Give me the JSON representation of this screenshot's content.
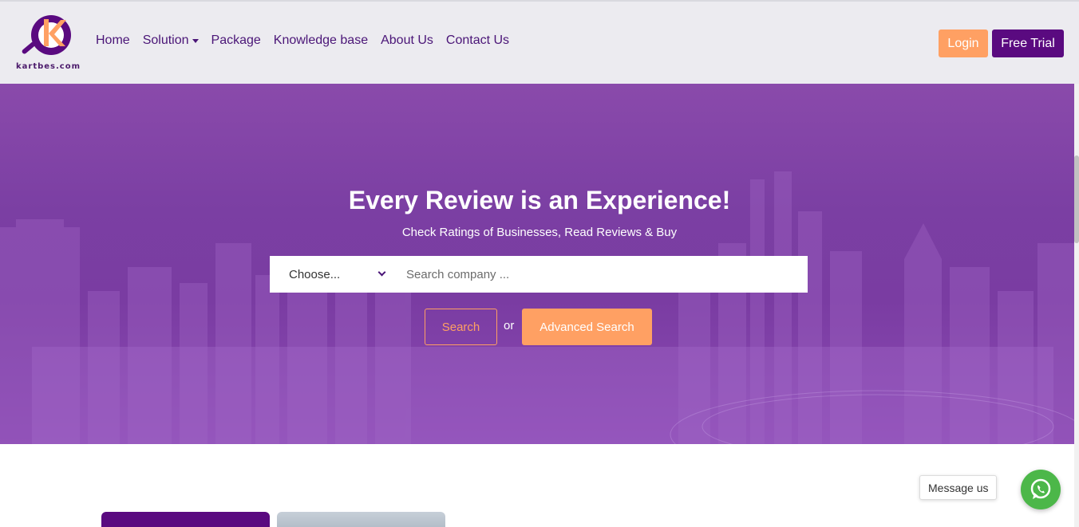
{
  "brand": {
    "logo_text": "kartbes.com",
    "colors": {
      "primary": "#5a0a80",
      "accent": "#ffa063",
      "nav_text": "#4a1577",
      "whatsapp": "#4cb749"
    }
  },
  "nav": {
    "items": [
      {
        "label": "Home"
      },
      {
        "label": "Solution",
        "has_dropdown": true
      },
      {
        "label": "Package"
      },
      {
        "label": "Knowledge base"
      },
      {
        "label": "About Us"
      },
      {
        "label": "Contact Us"
      }
    ],
    "login_label": "Login",
    "trial_label": "Free Trial"
  },
  "hero": {
    "title": "Every Review is an Experience!",
    "subtitle": "Check Ratings of Businesses, Read Reviews & Buy",
    "select_value": "Choose...",
    "search_placeholder": "Search company ...",
    "search_label": "Search",
    "or_label": "or",
    "advanced_label": "Advanced Search"
  },
  "chat": {
    "message_label": "Message us",
    "icon": "whatsapp-icon"
  }
}
